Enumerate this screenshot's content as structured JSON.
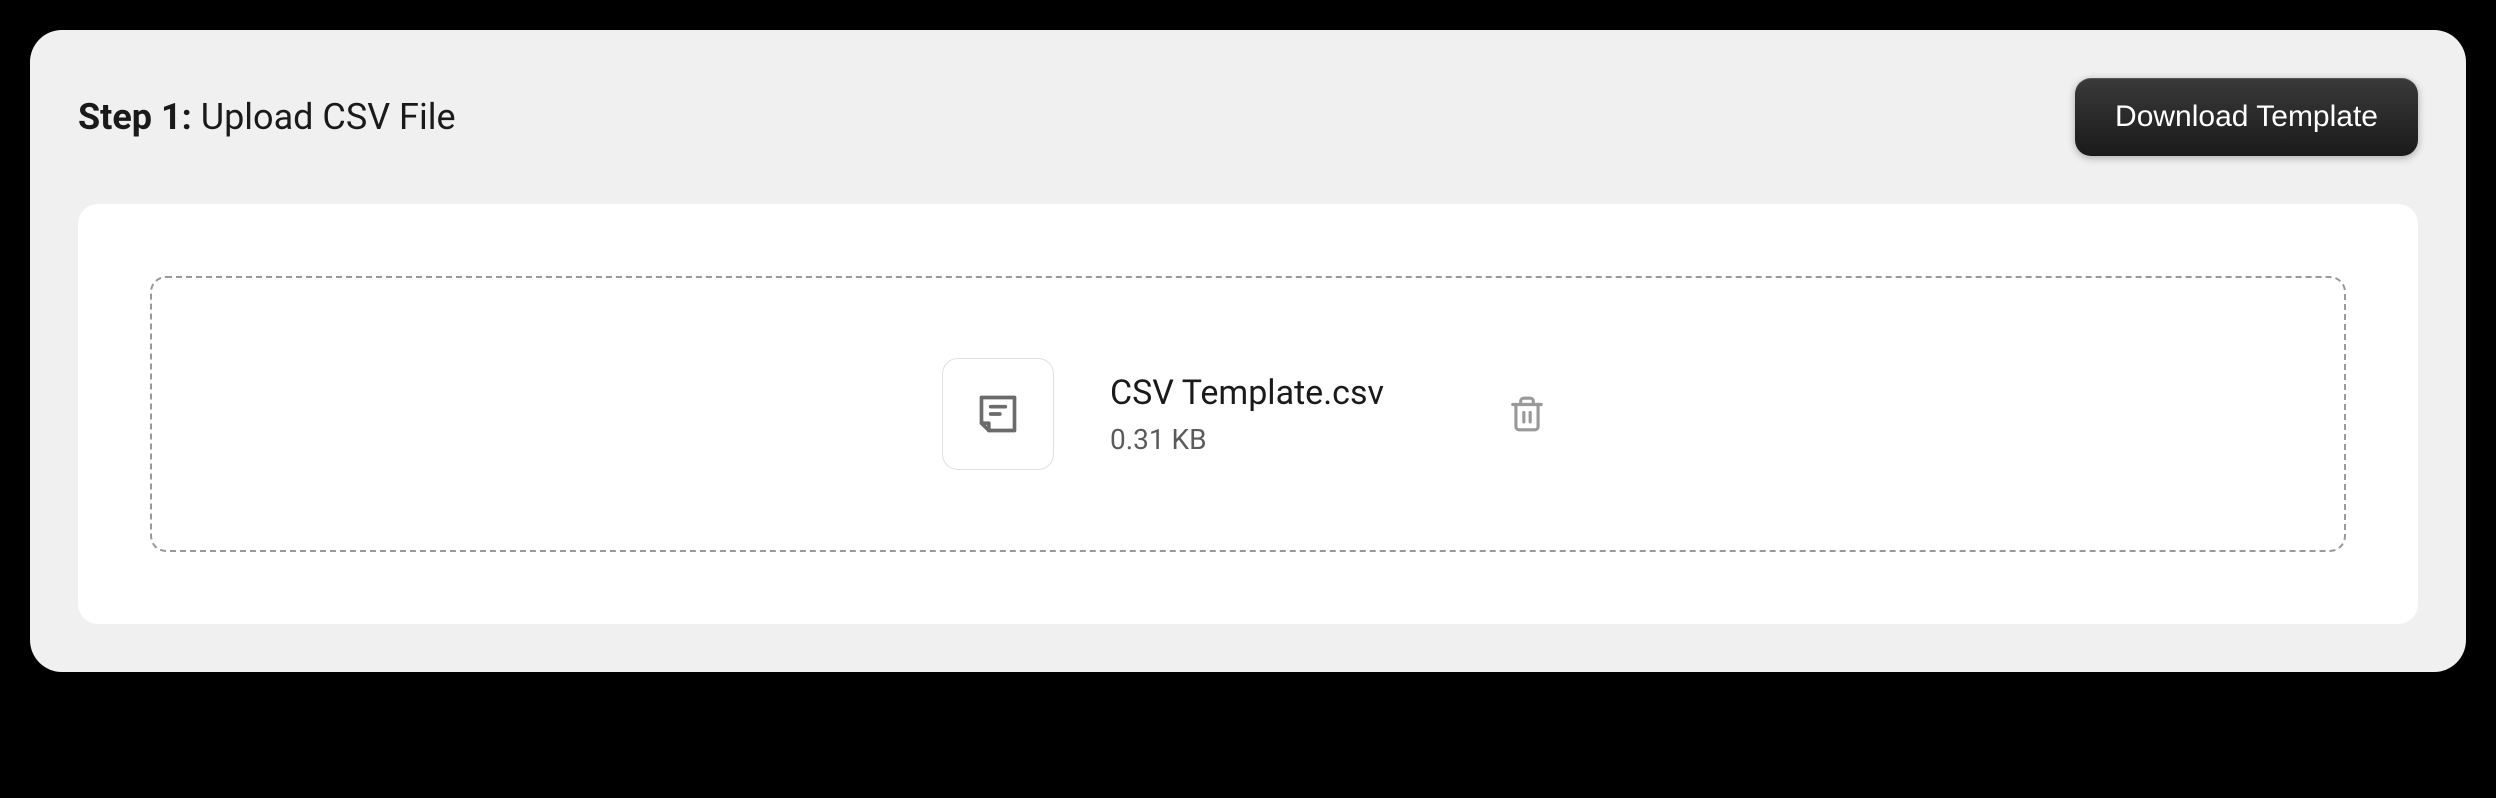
{
  "header": {
    "step_prefix": "Step 1:",
    "step_title": "Upload CSV File",
    "download_button_label": "Download Template"
  },
  "file": {
    "name": "CSV Template.csv",
    "size": "0.31 KB"
  }
}
